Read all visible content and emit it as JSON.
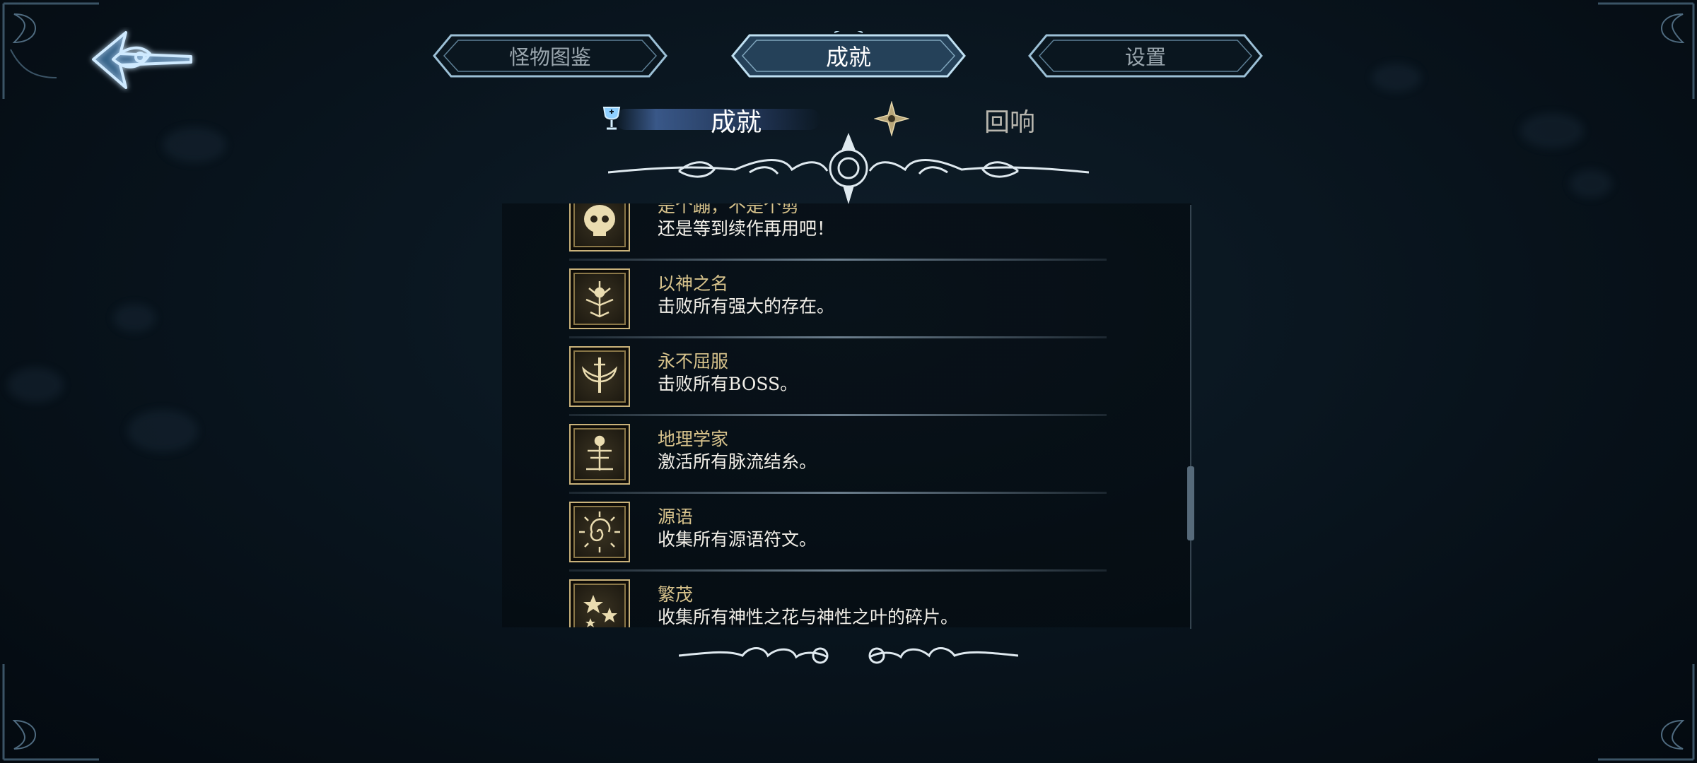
{
  "top_tabs": [
    {
      "label": "怪物图鉴",
      "active": false
    },
    {
      "label": "成就",
      "active": true
    },
    {
      "label": "设置",
      "active": false
    }
  ],
  "sub_tabs": [
    {
      "label": "成就",
      "icon": "chalice-icon",
      "active": true
    },
    {
      "label": "回响",
      "icon": "star-ornament-icon",
      "active": false
    }
  ],
  "achievements": [
    {
      "title": "是个蹦，不是个剪",
      "desc": "还是等到续作再用吧！",
      "icon": "skull-icon"
    },
    {
      "title": "以神之名",
      "desc": "击败所有强大的存在。",
      "icon": "deity-icon"
    },
    {
      "title": "永不屈服",
      "desc": "击败所有BOSS。",
      "icon": "sword-wings-icon"
    },
    {
      "title": "地理学家",
      "desc": "激活所有脉流结糸。",
      "icon": "totem-icon"
    },
    {
      "title": "源语",
      "desc": "收集所有源语符文。",
      "icon": "rune-spiral-icon"
    },
    {
      "title": "繁茂",
      "desc": "收集所有神性之花与神性之叶的碎片。",
      "icon": "flowers-icon"
    }
  ],
  "colors": {
    "accent_gold": "#d8c38c",
    "ui_silver": "#b9d4e6",
    "active_glow": "#5f8cdc"
  }
}
